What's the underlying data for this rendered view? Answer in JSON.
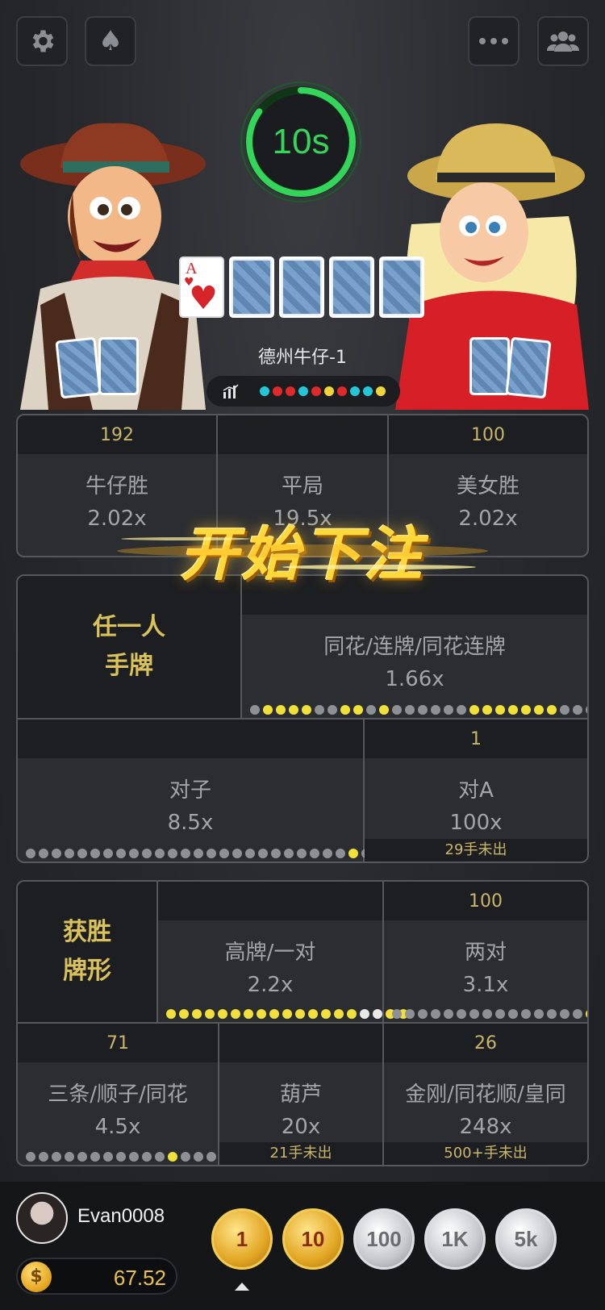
{
  "topbar": {
    "settings_icon": "gear-icon",
    "suit_icon": "spade-icon",
    "more_icon": "more-icon",
    "players_icon": "group-icon"
  },
  "timer": {
    "text": "10s",
    "progress": 0.85,
    "color": "#35d45a"
  },
  "board": {
    "cards": [
      {
        "rank": "A",
        "suit": "♥",
        "face_up": true
      },
      {
        "face_up": false
      },
      {
        "face_up": false
      },
      {
        "face_up": false
      },
      {
        "face_up": false
      }
    ]
  },
  "table_name": "德州牛仔-1",
  "roadmap": {
    "icon": "chart-icon",
    "dots": [
      "#22c7d8",
      "#e02a2a",
      "#e02a2a",
      "#22c7d8",
      "#e02a2a",
      "#f0d43a",
      "#e02a2a",
      "#22c7d8",
      "#22c7d8",
      "#f0d43a"
    ]
  },
  "banner": "开始下注",
  "main_bets": [
    {
      "count": "192",
      "label": "牛仔胜",
      "odds": "2.02x"
    },
    {
      "count": "",
      "label": "平局",
      "odds": "19.5x"
    },
    {
      "count": "100",
      "label": "美女胜",
      "odds": "2.02x"
    }
  ],
  "any_hand": {
    "title_line1": "任一人",
    "title_line2": "手牌",
    "flush": {
      "count": "",
      "label": "同花/连牌/同花连牌",
      "odds": "1.66x"
    },
    "pair": {
      "count": "",
      "label": "对子",
      "odds": "8.5x"
    },
    "pair_a": {
      "count": "1",
      "label": "对A",
      "odds": "100x",
      "note": "29手未出"
    }
  },
  "winning_hand": {
    "title_line1": "获胜",
    "title_line2": "牌形",
    "high_pair": {
      "count": "",
      "label": "高牌/一对",
      "odds": "2.2x"
    },
    "two_pair": {
      "count": "100",
      "label": "两对",
      "odds": "3.1x"
    },
    "trips": {
      "count": "71",
      "label": "三条/顺子/同花",
      "odds": "4.5x"
    },
    "full_house": {
      "count": "",
      "label": "葫芦",
      "odds": "20x",
      "note": "21手未出"
    },
    "quads": {
      "count": "26",
      "label": "金刚/同花顺/皇同",
      "odds": "248x",
      "note": "500+手未出"
    }
  },
  "dot_rows": {
    "flush": "gyyyyggyygyggggggyyyyyyyggggyy",
    "pair": "gggggggggggggggggggggggggyggg",
    "high_pair": "yyyyyyyyyyyyyyywwyy",
    "two_pair": "gggggggggggggggy",
    "trips": "gggggggggggyggggg"
  },
  "player": {
    "name": "Evan0008",
    "balance": "67.52",
    "coin_symbol": "$"
  },
  "chips": [
    {
      "label": "1",
      "style": "gold"
    },
    {
      "label": "10",
      "style": "gold"
    },
    {
      "label": "100",
      "style": "silver"
    },
    {
      "label": "1K",
      "style": "silver"
    },
    {
      "label": "5k",
      "style": "silver"
    }
  ]
}
